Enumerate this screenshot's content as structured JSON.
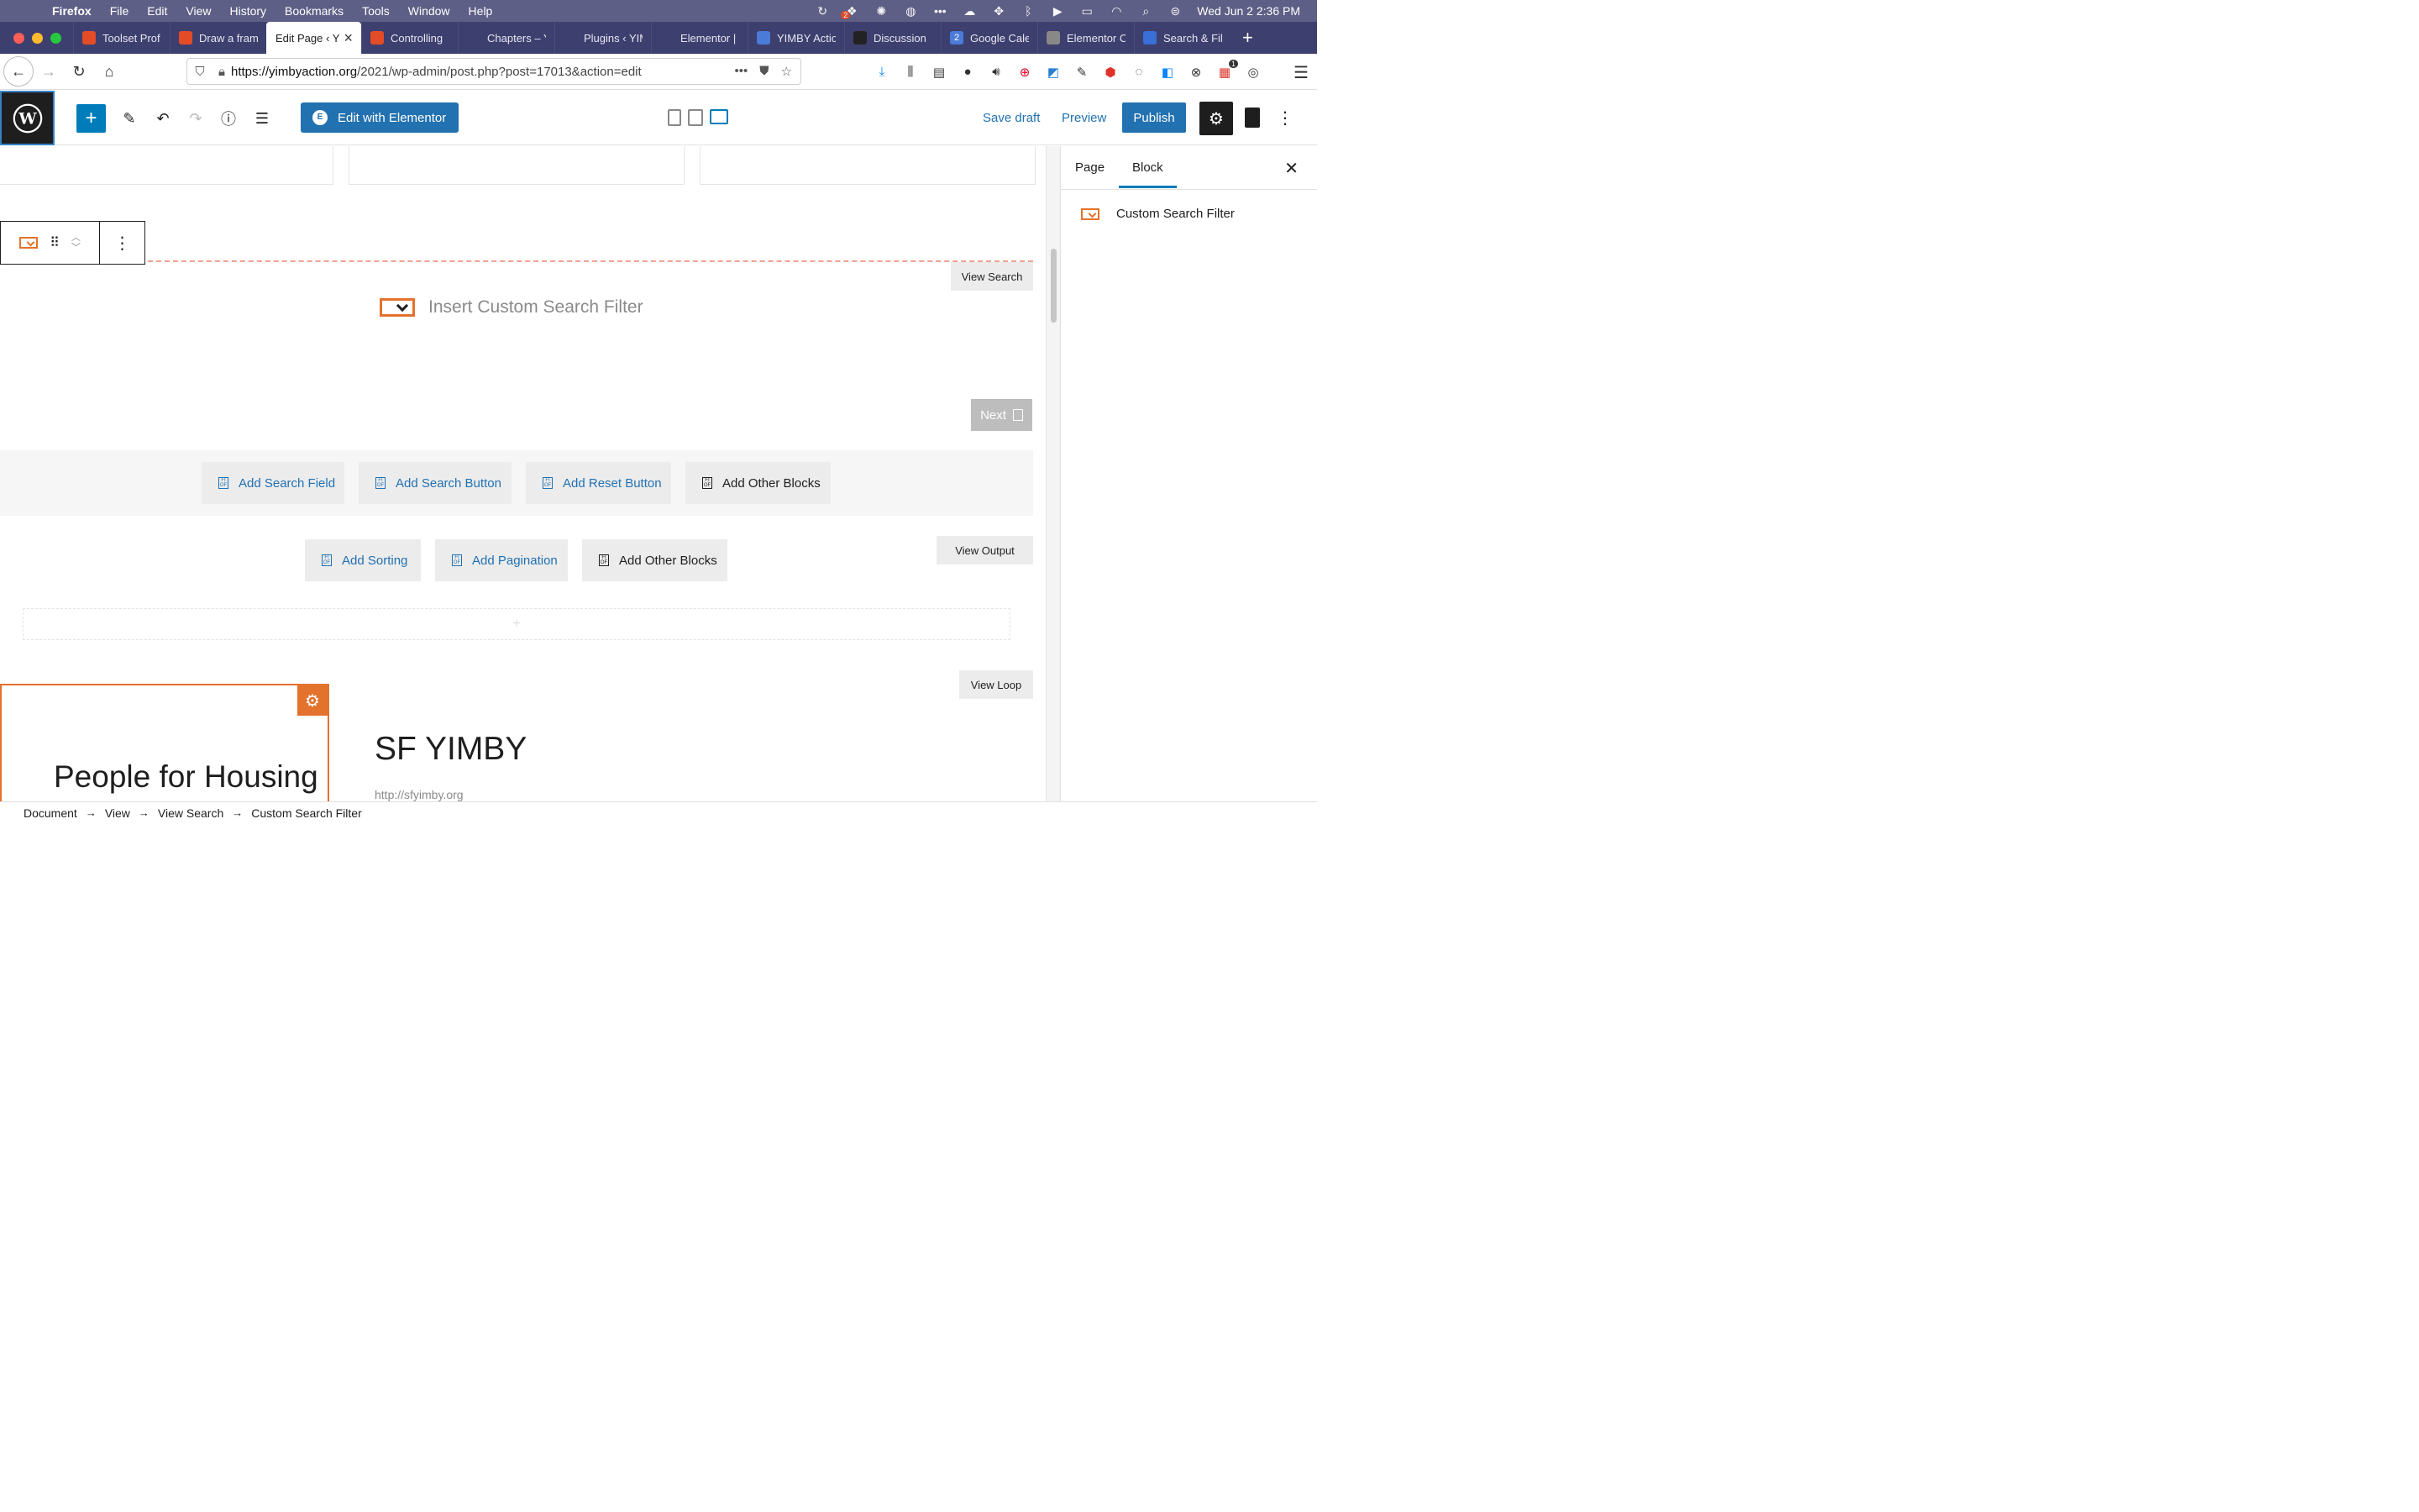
{
  "menubar": {
    "app": "Firefox",
    "items": [
      "File",
      "Edit",
      "View",
      "History",
      "Bookmarks",
      "Tools",
      "Window",
      "Help"
    ],
    "clock": "Wed Jun 2  2:36 PM",
    "badge": "2"
  },
  "tabs": [
    {
      "title": "Toolset Prof",
      "color": "#e34c26"
    },
    {
      "title": "Draw a fram",
      "color": "#e34c26"
    },
    {
      "title": "Edit Page ‹ Y",
      "active": true
    },
    {
      "title": "Controlling",
      "color": "#e34c26"
    },
    {
      "title": "Chapters – YIMB"
    },
    {
      "title": "Plugins ‹ YIMBY"
    },
    {
      "title": "Elementor |"
    },
    {
      "title": "YIMBY Actio",
      "color": "#4a7bd8"
    },
    {
      "title": "Discussion",
      "color": "#222"
    },
    {
      "title": "Google Cale",
      "color": "#4a7bd8",
      "glyph": "2"
    },
    {
      "title": "Elementor C",
      "color": "#888"
    },
    {
      "title": "Search & Fil",
      "color": "#3a6fd8"
    }
  ],
  "urlbar": {
    "host": "https://yimbyaction.org",
    "path": "/2021/wp-admin/post.php?post=17013&action=edit"
  },
  "extensions": {
    "badge": "1"
  },
  "wp_toolbar": {
    "edit_with_elementor": "Edit with Elementor",
    "save_draft": "Save draft",
    "preview": "Preview",
    "publish": "Publish"
  },
  "canvas": {
    "view_search": "View Search",
    "insert_filter": "Insert Custom Search Filter",
    "next": "Next",
    "search_buttons": [
      "Add Search Field",
      "Add Search Button",
      "Add Reset Button",
      "Add Other Blocks"
    ],
    "view_output": "View Output",
    "output_buttons": [
      "Add Sorting",
      "Add Pagination",
      "Add Other Blocks"
    ],
    "appender": "+",
    "view_loop": "View Loop",
    "card_text": "People for Housing",
    "item_title": "SF YIMBY",
    "item_url": "http://sfyimby.org"
  },
  "sidebar": {
    "tab_page": "Page",
    "tab_block": "Block",
    "block_name": "Custom Search Filter"
  },
  "breadcrumb": [
    "Document",
    "View",
    "View Search",
    "Custom Search Filter"
  ],
  "colors": {
    "accent": "#2271b1",
    "toolset_orange": "#e3722d",
    "menubar": "#5e5f86",
    "tabbar": "#3d3f6e"
  }
}
